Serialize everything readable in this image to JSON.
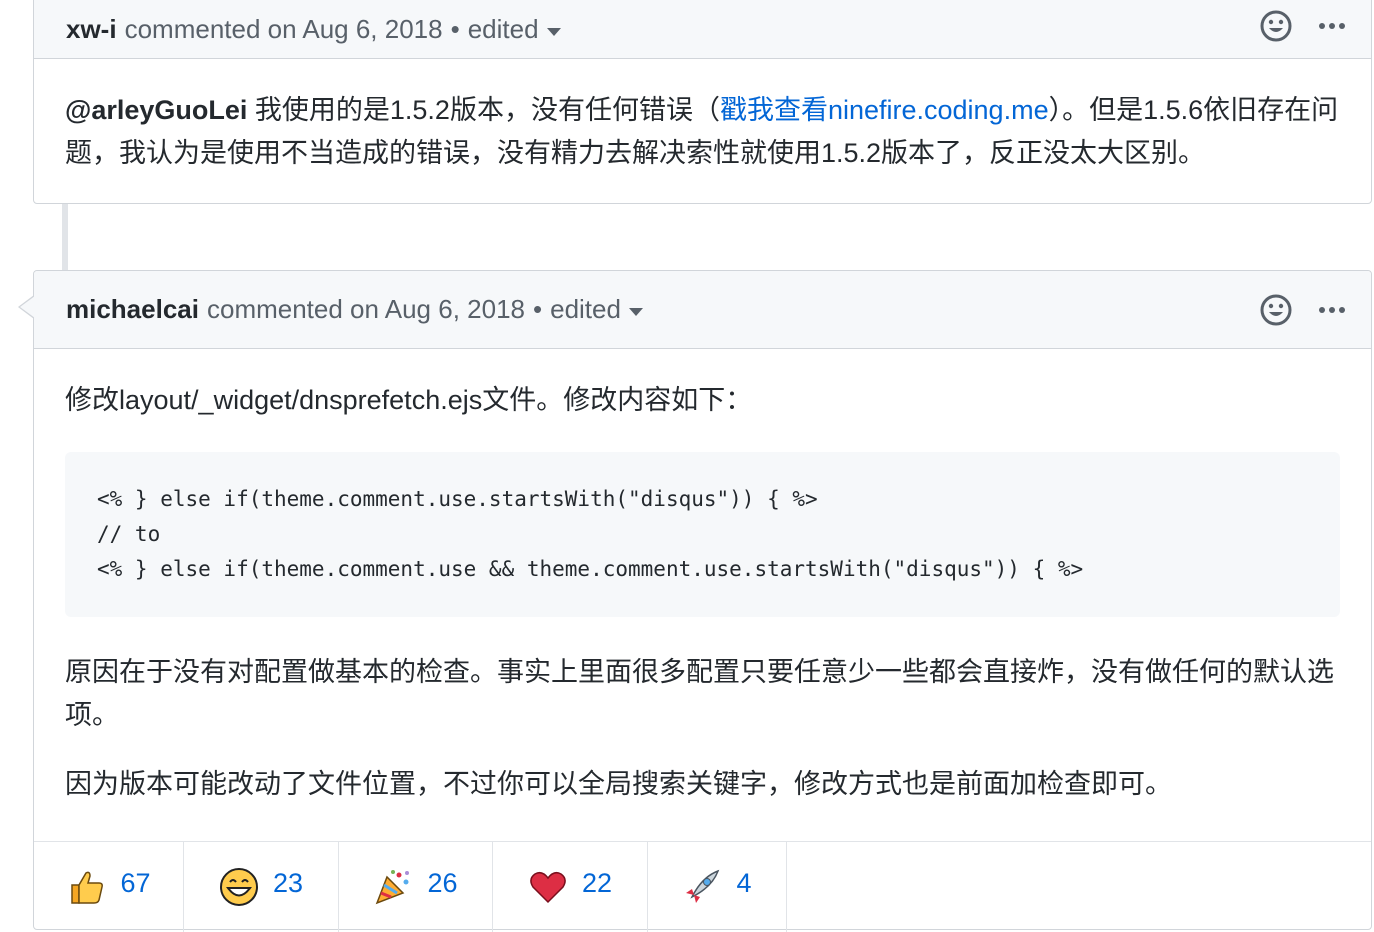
{
  "comments": [
    {
      "author": "xw-i",
      "meta": "commented on Aug 6, 2018",
      "separator": "•",
      "edited": "edited",
      "body": {
        "mention": "@arleyGuoLei",
        "text_before_link": " 我使用的是1.5.2版本，没有任何错误（",
        "link_text": "戳我查看ninefire.coding.me",
        "text_after_link": "）。但是1.5.6依旧存在问题，我认为是使用不当造成的错误，没有精力去解决索性就使用1.5.2版本了，反正没太大区别。"
      }
    },
    {
      "author": "michaelcai",
      "meta": "commented on Aug 6, 2018",
      "separator": "•",
      "edited": "edited",
      "body": {
        "intro": "修改layout/_widget/dnsprefetch.ejs文件。修改内容如下：",
        "code_lines": [
          "<% } else if(theme.comment.use.startsWith(\"disqus\")) { %>",
          "// to",
          "<% } else if(theme.comment.use && theme.comment.use.startsWith(\"disqus\")) { %>"
        ],
        "paragraph_1": "原因在于没有对配置做基本的检查。事实上里面很多配置只要任意少一些都会直接炸，没有做任何的默认选项。",
        "paragraph_2": "因为版本可能改动了文件位置，不过你可以全局搜索关键字，修改方式也是前面加检查即可。"
      },
      "reactions": [
        {
          "icon": "thumbs-up-icon",
          "count": "67"
        },
        {
          "icon": "smile-icon",
          "count": "23"
        },
        {
          "icon": "tada-icon",
          "count": "26"
        },
        {
          "icon": "heart-icon",
          "count": "22"
        },
        {
          "icon": "rocket-icon",
          "count": "4"
        }
      ]
    }
  ],
  "colors": {
    "link": "#0366d6",
    "header_bg": "#f6f8fa",
    "border": "#d1d5da"
  }
}
